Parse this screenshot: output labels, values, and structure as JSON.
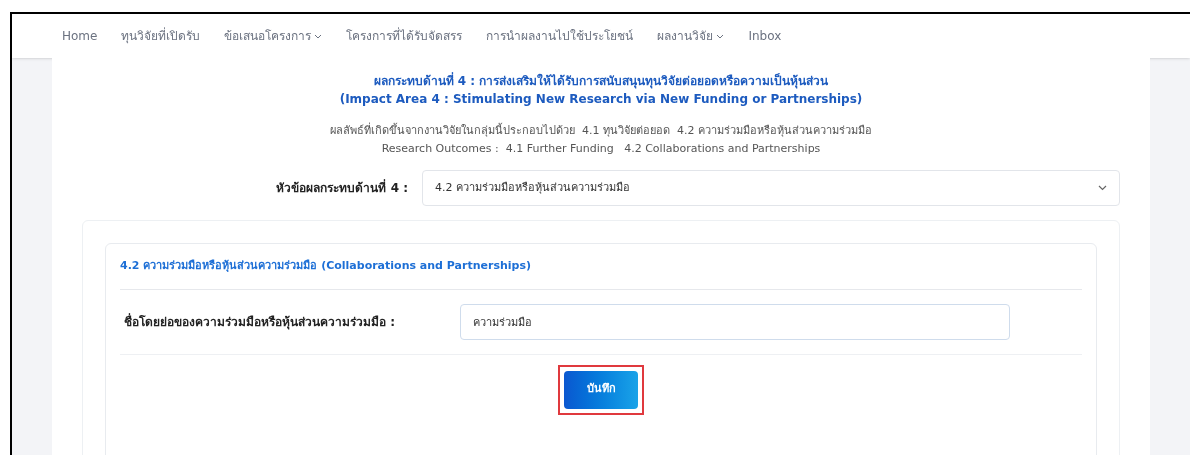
{
  "nav": [
    {
      "label": "Home",
      "has_menu": false
    },
    {
      "label": "ทุนวิจัยที่เปิดรับ",
      "has_menu": false
    },
    {
      "label": "ข้อเสนอโครงการ",
      "has_menu": true
    },
    {
      "label": "โครงการที่ได้รับจัดสรร",
      "has_menu": false
    },
    {
      "label": "การนำผลงานไปใช้ประโยชน์",
      "has_menu": false
    },
    {
      "label": "ผลงานวิจัย",
      "has_menu": true
    },
    {
      "label": "Inbox",
      "has_menu": false
    }
  ],
  "heading": {
    "title": "ผลกระทบด้านที่ 4 : การส่งเสริมให้ได้รับการสนับสนุนทุนวิจัยต่อยอดหรือความเป็นหุ้นส่วน",
    "subtitle": "(Impact Area 4 : Stimulating New Research via New Funding or Partnerships)"
  },
  "outcomes": [
    "ผลลัพธ์ที่เกิดขึ้นจากงานวิจัยในกลุ่มนี้ประกอบไปด้วย  4.1 ทุนวิจัยต่อยอด  4.2 ความร่วมมือหรือหุ้นส่วนความร่วมมือ",
    "Research Outcomes :  4.1 Further Funding   4.2 Collaborations and Partnerships"
  ],
  "topic_select": {
    "label": "หัวข้อผลกระทบด้านที่ 4 :",
    "value": "4.2 ความร่วมมือหรือหุ้นส่วนความร่วมมือ"
  },
  "section": {
    "title": "4.2 ความร่วมมือหรือหุ้นส่วนความร่วมมือ (Collaborations and Partnerships)",
    "field": {
      "label": "ชื่อโดยย่อของความร่วมมือหรือหุ้นส่วนความร่วมมือ :",
      "value": "ความร่วมมือ"
    },
    "save_button": {
      "label": "บันทึก",
      "highlighted": true
    }
  }
}
